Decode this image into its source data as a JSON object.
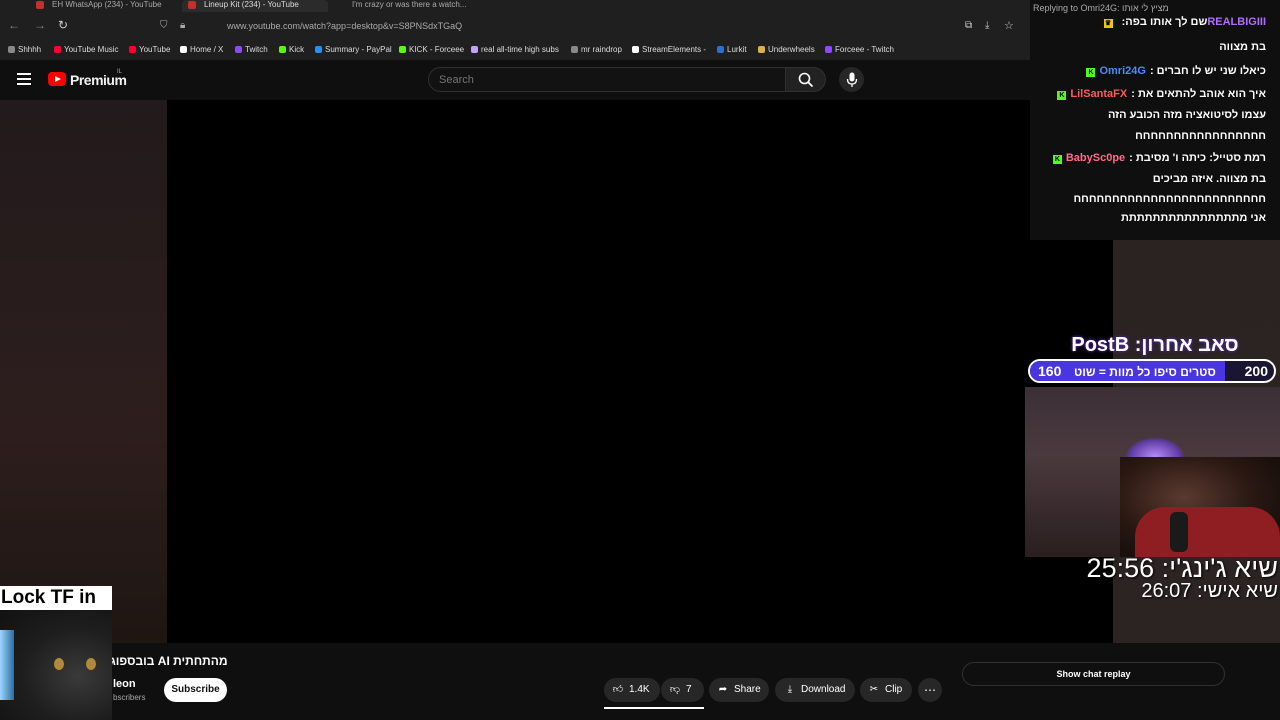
{
  "browser": {
    "tabs": [
      {
        "label": "EH WhatsApp (234) - YouTube"
      },
      {
        "label": "Lineup Kit (234) - YouTube"
      },
      {
        "label": "I'm crazy or was there a watch..."
      }
    ],
    "url": "www.youtube.com/watch?app=desktop&v=S8PNSdxTGaQ",
    "bookmarks": [
      {
        "label": "Shhhh",
        "color": "#888888"
      },
      {
        "label": "YouTube Music",
        "color": "#ff0033"
      },
      {
        "label": "YouTube",
        "color": "#ff0033"
      },
      {
        "label": "Home / X",
        "color": "#ffffff"
      },
      {
        "label": "Twitch",
        "color": "#9146ff"
      },
      {
        "label": "Kick",
        "color": "#53fc18"
      },
      {
        "label": "Summary - PayPal",
        "color": "#1e90ff"
      },
      {
        "label": "KICK - Forceee",
        "color": "#53fc18"
      },
      {
        "label": "real all-time high subs",
        "color": "#c8a0ff"
      },
      {
        "label": "mr raindrop",
        "color": "#888888"
      },
      {
        "label": "StreamElements -",
        "color": "#ffffff"
      },
      {
        "label": "Lurkit",
        "color": "#2a6fd6"
      },
      {
        "label": "Underwheels",
        "color": "#d9b34a"
      },
      {
        "label": "Forceee - Twitch",
        "color": "#9146ff"
      }
    ]
  },
  "youtube": {
    "brand": "Premium",
    "brand_sup": "IL",
    "search_placeholder": "Search",
    "video_title": "מהתחתית AI בובספוג",
    "channel_name": "leon",
    "subscribers": "bscribers",
    "subscribe_label": "Subscribe",
    "likes": "1.4K",
    "dislikes": "7",
    "share_label": "Share",
    "download_label": "Download",
    "clip_label": "Clip",
    "show_chat_label": "Show chat replay"
  },
  "overlay": {
    "lock_text": "Lock TF in",
    "chat": {
      "reply_to": "Replying to Omri24G: מציץ לי אותו",
      "first_line_user": "REALBIGIII",
      "first_line_text": "שם לך אותו בפה:",
      "lines": [
        {
          "user": "",
          "text": "בת מצווה",
          "color": "#ffffff"
        },
        {
          "user": "Omri24G",
          "text": "כיאלו שני יש לו חברים :",
          "color": "#4a8cff"
        },
        {
          "user": "LilSantaFX",
          "text": "איך הוא אוהב להתאים את :",
          "color": "#ff5a5a"
        },
        {
          "user": "",
          "text": "עצמו לסיטואציה מזה הכובע הזה",
          "color": "#ffffff"
        },
        {
          "user": "",
          "text": "חחחחחחחחחחחחחחחחח",
          "color": "#ffffff"
        },
        {
          "user": "BabySc0pe",
          "text": "רמת סטייל: כיתה ו' מסיבת :",
          "color": "#ff6b8b"
        },
        {
          "user": "",
          "text": "בת מצווה. איזה מביכים",
          "color": "#ffffff"
        },
        {
          "user": "",
          "text": "חחחחחחחחחחחחחחחחחחחחחחחחח",
          "color": "#ffffff"
        },
        {
          "user": "",
          "text": "אני מתתתתתתתתתתתתתתת",
          "color": "#ffffff"
        }
      ]
    },
    "last_sub_label": "סאב אחרון: PostB",
    "goal": {
      "current": "160",
      "target": "200",
      "text": "סטרים סיפו כל מוות = שוט",
      "progress": 0.8
    },
    "timer_ginger": "שיא ג'ינג'י: 25:56",
    "timer_personal": "שיא אישי: 26:07"
  }
}
